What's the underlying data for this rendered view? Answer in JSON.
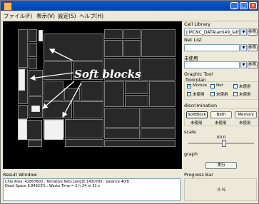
{
  "menu": {
    "items": [
      "ファイル(F)",
      "表示(V)",
      "設定(S)",
      "ヘルプ(H)"
    ]
  },
  "callout": "Soft blocks",
  "right": {
    "cell_library_label": "Cell Library",
    "cell_library_value": "J:MCNC_DATA\\ami49_lath",
    "ref_button": "参照...",
    "net_list_label": "Net List",
    "unused_label": "未使用",
    "graphic_tool_label": "Graphic Tool",
    "floorplan_label": "floorplan",
    "module_label": "Module",
    "net_label": "Net",
    "discrimination_label": "discrimination",
    "softblock_button": "SoftBlock",
    "bath_button": "Bath",
    "memory_button": "Memory",
    "scale_label": "scale",
    "scale_value": "60.0",
    "scale_level": 0.55,
    "graph_label": "graph",
    "execute_button": "実行"
  },
  "result": {
    "label": "Result Window",
    "line1": "Chip Area: 42867600 : Tentative Nets Length 1430795 : balance 40/8",
    "line2": "Dead Space 6.84623% : Waste Time = 2 h 24 m 31 s"
  },
  "progress": {
    "label": "Progress Bar",
    "value_text": "0 %"
  }
}
